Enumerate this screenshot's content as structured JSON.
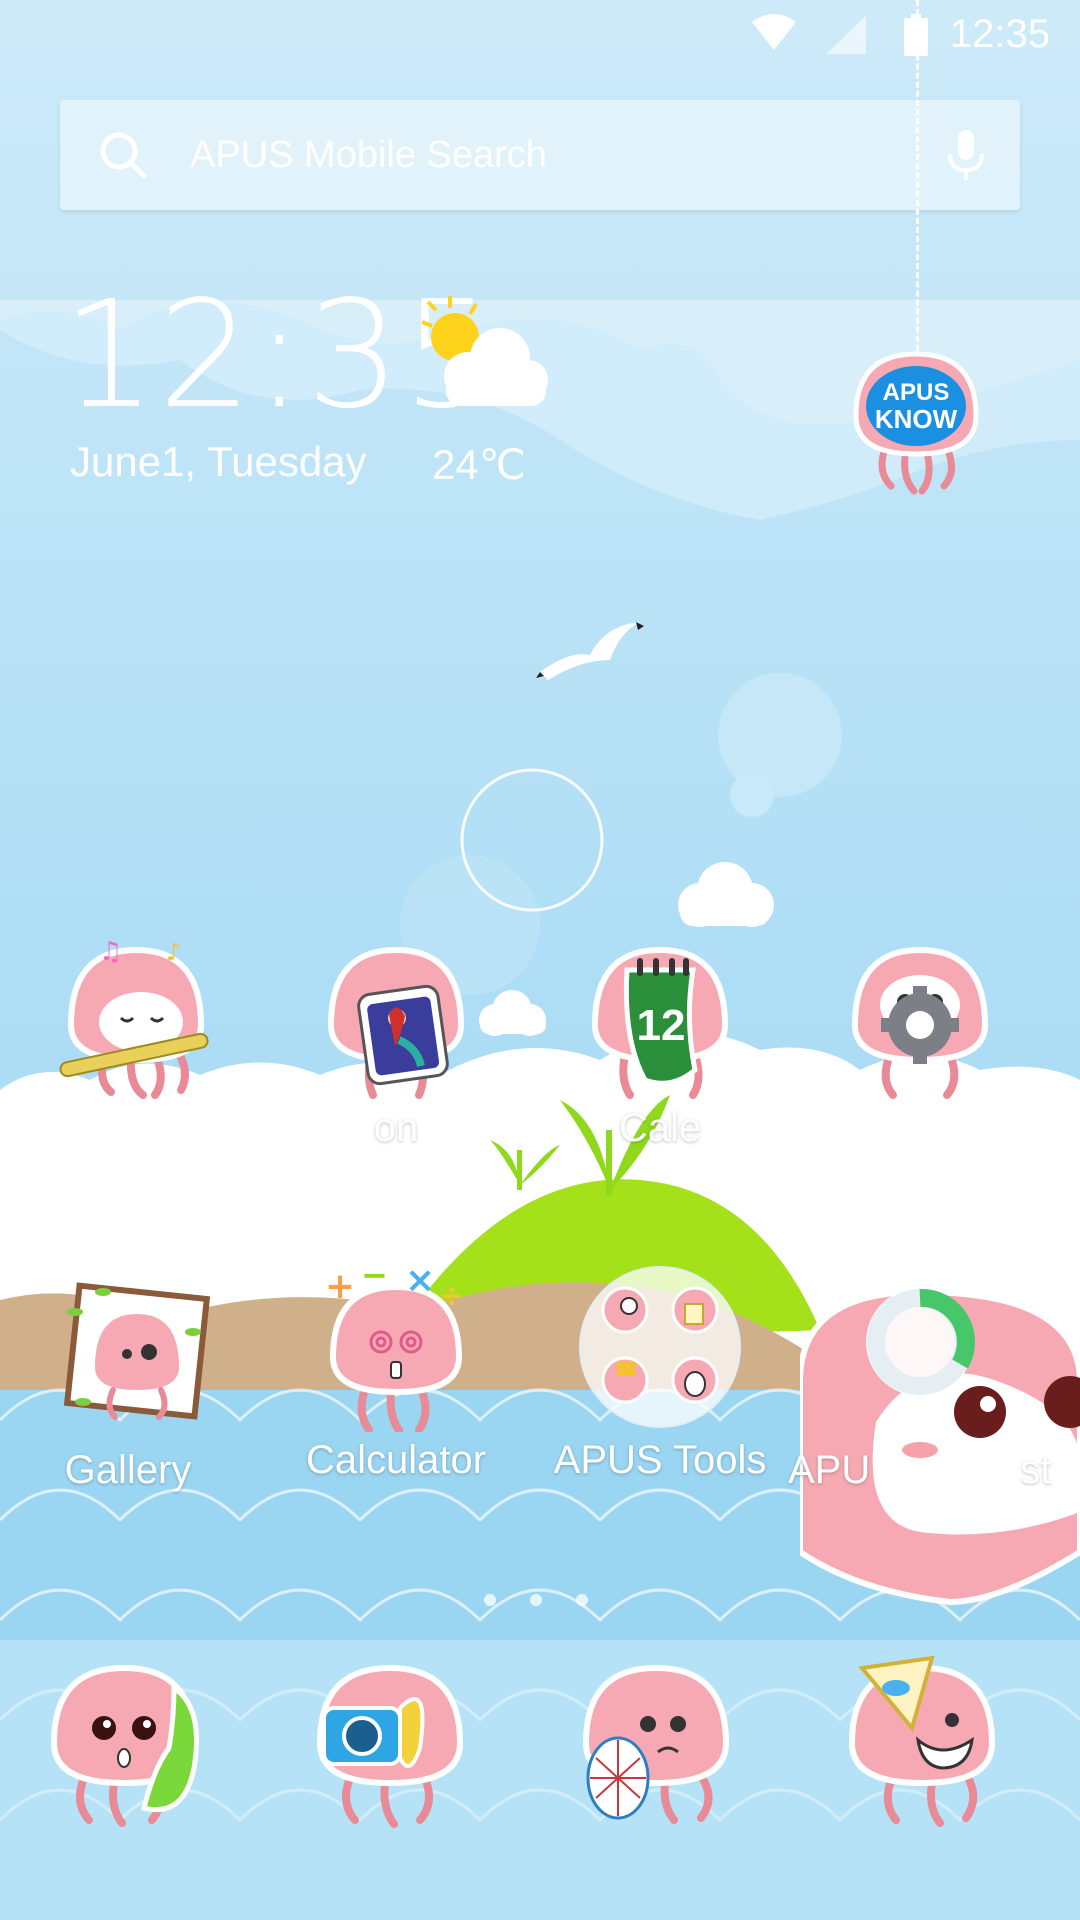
{
  "status_bar": {
    "time": "12:35",
    "icons": [
      "wifi-icon",
      "signal-icon",
      "battery-icon"
    ]
  },
  "search": {
    "placeholder": "APUS Mobile Search",
    "icons": [
      "search-icon",
      "mic-icon"
    ]
  },
  "clock_widget": {
    "time": "12:35",
    "date": "June1, Tuesday",
    "temperature": "24℃",
    "weather_icon": "partly-cloudy-icon"
  },
  "know_widget": {
    "line1": "APUS",
    "line2": "KNOW"
  },
  "home_apps_row1": [
    {
      "name": "music-app",
      "label": ""
    },
    {
      "name": "icon-pack-app",
      "label": "on"
    },
    {
      "name": "calendar-app",
      "label": "Cale",
      "badge": "12"
    },
    {
      "name": "settings-app",
      "label": ""
    }
  ],
  "home_apps_row2": [
    {
      "name": "gallery-app",
      "label": "Gallery"
    },
    {
      "name": "calculator-app",
      "label": "Calculator"
    },
    {
      "name": "apus-tools-folder",
      "label": "APUS Tools"
    },
    {
      "name": "apus-booster-app",
      "label": "APU",
      "label2": "st"
    }
  ],
  "page_indicator": {
    "pages": 3,
    "current": 1
  },
  "dock": [
    {
      "name": "phone-icon"
    },
    {
      "name": "camera-icon"
    },
    {
      "name": "browser-icon"
    },
    {
      "name": "messages-icon"
    }
  ],
  "colors": {
    "sky": "#b5e0f6",
    "jelly_pink": "#f6a9b3",
    "leaf_green": "#9be22a",
    "wave_blue": "#8fd0f0"
  }
}
